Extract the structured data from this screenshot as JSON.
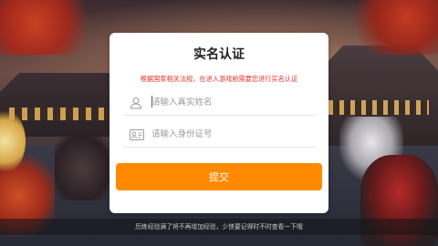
{
  "dialog": {
    "title": "实名认证",
    "notice": "根据国家相关法规，在进入游戏前需要您进行实名认证",
    "name_field": {
      "icon": "person-icon",
      "placeholder": "请输入真实姓名",
      "value": ""
    },
    "id_field": {
      "icon": "id-card-icon",
      "placeholder": "请输入身份证号",
      "value": ""
    },
    "submit_label": "提交"
  },
  "tip": {
    "text": "历练经验满了将不再增加经验，少侠要记得时不时查看一下哦"
  },
  "colors": {
    "accent": "#ff8a00",
    "notice": "#e5322d",
    "title": "#222222"
  }
}
